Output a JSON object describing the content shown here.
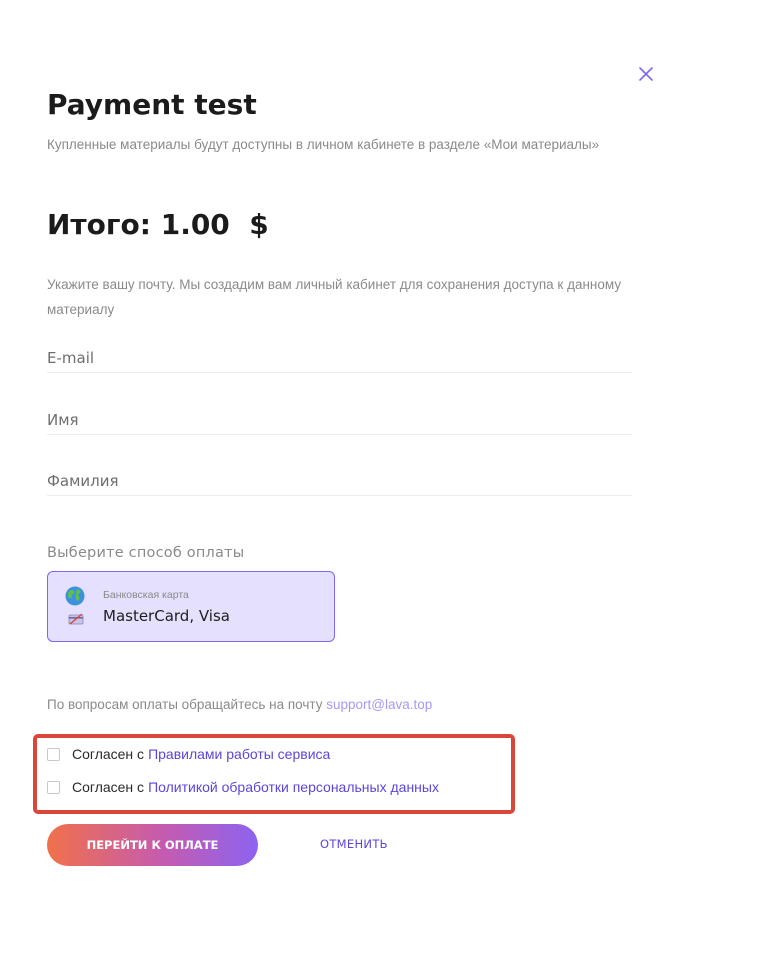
{
  "modal": {
    "title": "Payment test",
    "subtitle": "Купленные материалы будут доступны в личном кабинете в разделе «Мои материалы»",
    "total": "Итого: 1.00  $",
    "email_note": "Укажите вашу почту. Мы создадим вам личный кабинет для сохранения доступа к данному материалу"
  },
  "form": {
    "email_placeholder": "E-mail",
    "name_placeholder": "Имя",
    "surname_placeholder": "Фамилия"
  },
  "payment": {
    "label": "Выберите способ оплаты",
    "method_type": "Банковская карта",
    "method_brands": "MasterCard, Visa",
    "selected_color": "#e4e0fd",
    "accent_color": "#7c68ec"
  },
  "support": {
    "text": "По вопросам оплаты обращайтесь на почту ",
    "email": "support@lava.top"
  },
  "consents": [
    {
      "prefix": "Согласен с",
      "link": "Правилами работы сервиса",
      "checked": false
    },
    {
      "prefix": "Согласен с",
      "link": "Политикой обработки персональных данных",
      "checked": false
    }
  ],
  "actions": {
    "pay_label": "ПЕРЕЙТИ К ОПЛАТЕ",
    "cancel_label": "ОТМЕНИТЬ"
  },
  "icons": {
    "close": "close-icon",
    "globe": "globe-icon",
    "card": "card-icon"
  },
  "colors": {
    "highlight_border": "#d9463a",
    "link": "#5b46d8",
    "support_link": "#a79af2"
  }
}
